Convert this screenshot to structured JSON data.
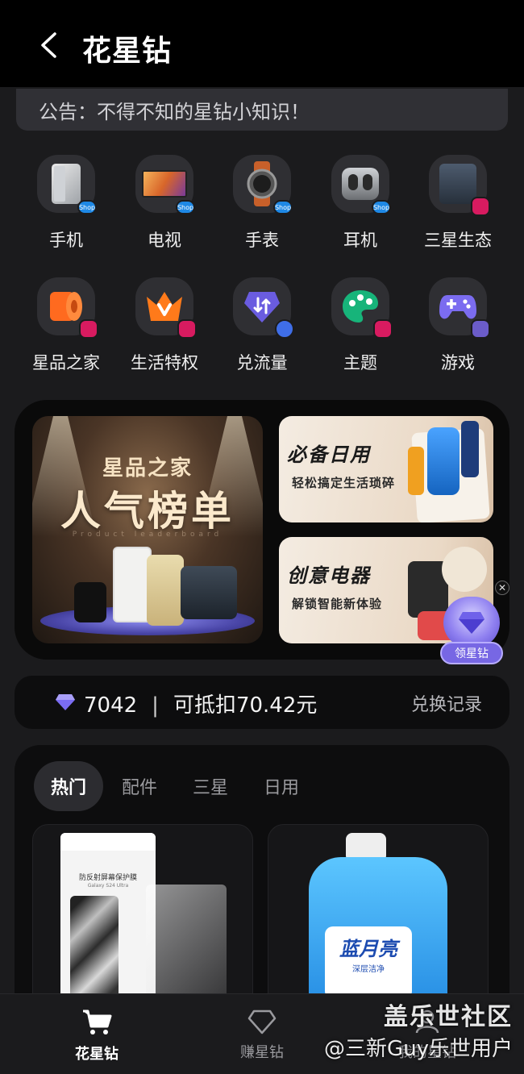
{
  "header": {
    "title": "花星钻"
  },
  "notice": {
    "text": "公告：不得不知的星钻小知识！"
  },
  "categories": [
    {
      "label": "手机",
      "icon": "phone-icon",
      "badge": "Shop"
    },
    {
      "label": "电视",
      "icon": "tv-icon",
      "badge": "Shop"
    },
    {
      "label": "手表",
      "icon": "watch-icon",
      "badge": "Shop"
    },
    {
      "label": "耳机",
      "icon": "earbuds-icon",
      "badge": "Shop"
    },
    {
      "label": "三星生态",
      "icon": "ecosystem-icon",
      "badge": ""
    },
    {
      "label": "星品之家",
      "icon": "home-goods-icon",
      "badge": ""
    },
    {
      "label": "生活特权",
      "icon": "crown-icon",
      "badge": ""
    },
    {
      "label": "兑流量",
      "icon": "data-exchange-icon",
      "badge": ""
    },
    {
      "label": "主题",
      "icon": "palette-icon",
      "badge": ""
    },
    {
      "label": "游戏",
      "icon": "gamepad-icon",
      "badge": ""
    }
  ],
  "banners": {
    "main": {
      "subtitle": "星品之家",
      "headline": "人气榜单",
      "tagline": "Product leaderboard"
    },
    "daily": {
      "title": "必备日用",
      "subtitle": "轻松搞定生活琐碎"
    },
    "electronics": {
      "title": "创意电器",
      "subtitle": "解锁智能新体验"
    },
    "claim_label": "领星钻"
  },
  "points": {
    "balance": "7042",
    "separator": "|",
    "deductible": "可抵扣70.42元",
    "exchange_link": "兑换记录"
  },
  "tabs": [
    {
      "label": "热门",
      "active": true
    },
    {
      "label": "配件",
      "active": false
    },
    {
      "label": "三星",
      "active": false
    },
    {
      "label": "日用",
      "active": false
    }
  ],
  "products": [
    {
      "name": "防反射屏幕保护膜",
      "note": "Galaxy S24 Ultra"
    },
    {
      "name": "蓝月亮",
      "note": "深层洁净"
    }
  ],
  "bottom_nav": [
    {
      "label": "花星钻",
      "icon": "cart-icon",
      "active": true
    },
    {
      "label": "赚星钻",
      "icon": "diamond-outline-icon",
      "active": false
    },
    {
      "label": "我的星钻",
      "icon": "user-icon",
      "active": false
    }
  ],
  "watermark": {
    "main": "盖乐世社区",
    "sub": "@三新Guy乐世用户"
  },
  "colors": {
    "accent": "#7767e4",
    "background": "#1b1b1d",
    "card": "#0d0d0e"
  }
}
